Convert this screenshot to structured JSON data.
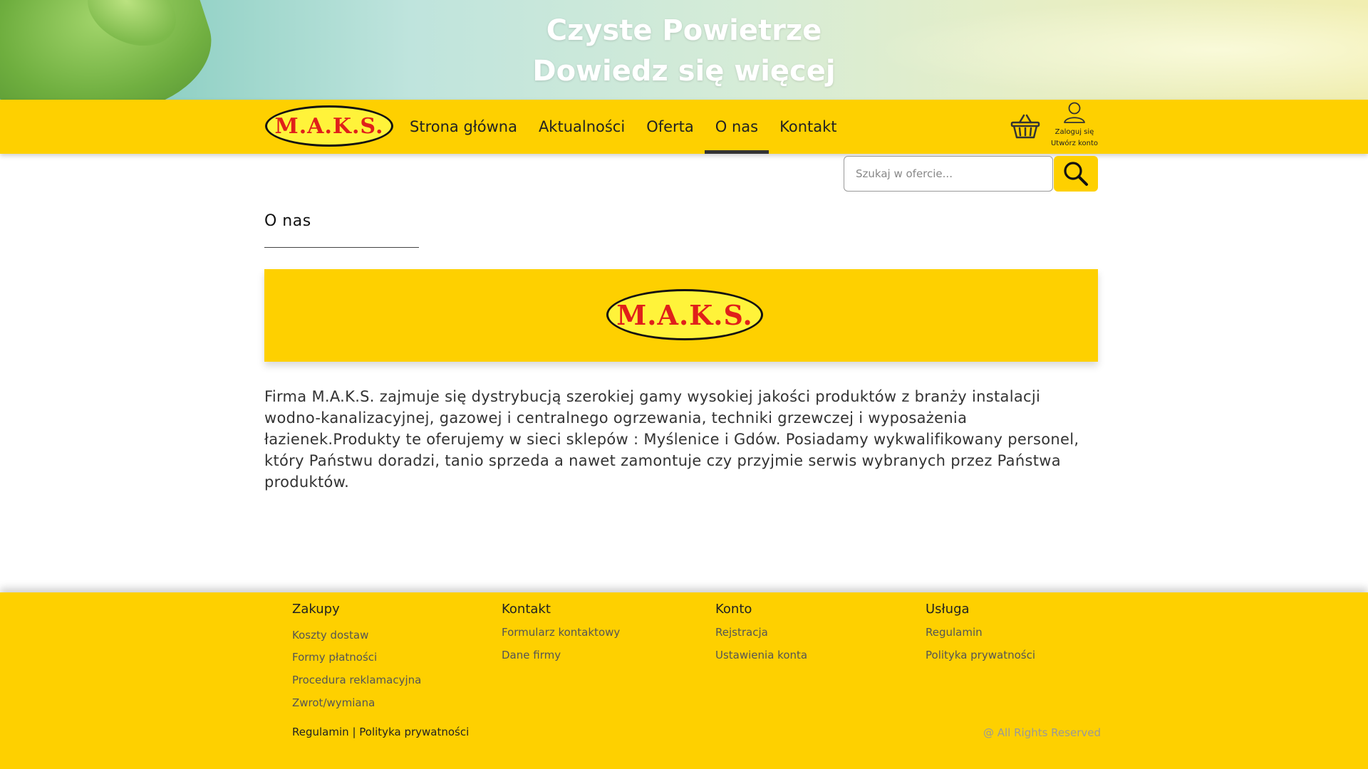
{
  "banner": {
    "line1": "Czyste Powietrze",
    "line2": "Dowiedz się więcej"
  },
  "nav": {
    "logo_text": "M.A.K.S.",
    "items": [
      {
        "label": "Strona główna",
        "active": false
      },
      {
        "label": "Aktualności",
        "active": false
      },
      {
        "label": "Oferta",
        "active": false
      },
      {
        "label": "O nas",
        "active": true
      },
      {
        "label": "Kontakt",
        "active": false
      }
    ],
    "account": {
      "login": "Zaloguj się",
      "register": "Utwórz konto"
    },
    "icons": [
      "basket-icon",
      "user-icon",
      "search-icon"
    ]
  },
  "search": {
    "placeholder": "Szukaj w ofercie..."
  },
  "content": {
    "title": "O nas",
    "hero_logo_text": "M.A.K.S.",
    "about": "Firma M.A.K.S. zajmuje się dystrybucją szerokiej gamy wysokiej jakości produktów z branży instalacji wodno-kanalizacyjnej, gazowej i centralnego ogrzewania, techniki grzewczej i wyposażenia łazienek.Produkty te oferujemy w sieci sklepów : Myślenice i Gdów. Posiadamy wykwalifikowany personel, który Państwu doradzi, tanio sprzeda a nawet zamontuje czy przyjmie serwis wybranych przez Państwa produktów."
  },
  "footer": {
    "columns": [
      {
        "heading": "Zakupy",
        "links": [
          "Koszty dostaw",
          "Formy płatności",
          "Procedura reklamacyjna",
          "Zwrot/wymiana"
        ]
      },
      {
        "heading": "Kontakt",
        "links": [
          "Formularz kontaktowy",
          "Dane firmy"
        ]
      },
      {
        "heading": "Konto",
        "links": [
          "Rejstracja",
          "Ustawienia konta"
        ]
      },
      {
        "heading": "Usługa",
        "links": [
          "Regulamin",
          "Polityka prywatności"
        ]
      }
    ],
    "bottom_left": {
      "regulamin": "Regulamin",
      "separator": "|",
      "polityka": "Polityka prywatności"
    },
    "copyright": "@ All Rights Reserved"
  },
  "colors": {
    "brand_yellow": "#fed000",
    "logo_red": "#e0201a",
    "logo_fill": "#fff33a"
  }
}
